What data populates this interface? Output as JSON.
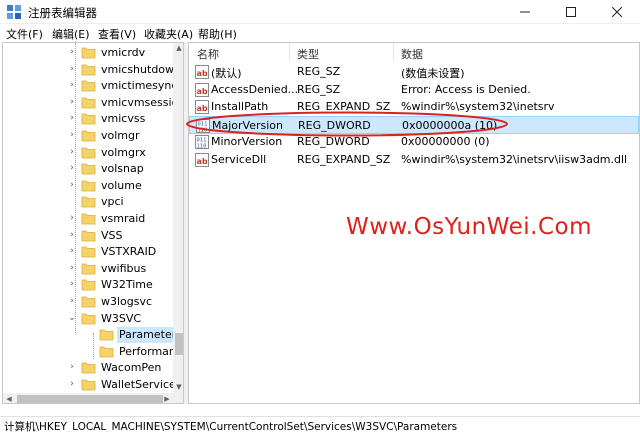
{
  "window": {
    "title": "注册表编辑器"
  },
  "menu": [
    "文件(F)",
    "编辑(E)",
    "查看(V)",
    "收藏夹(A)",
    "帮助(H)"
  ],
  "tree": {
    "items": [
      {
        "label": "vmicrdv",
        "expander": "›"
      },
      {
        "label": "vmicshutdown",
        "expander": "›"
      },
      {
        "label": "vmictimesync",
        "expander": "›"
      },
      {
        "label": "vmicvmsession",
        "expander": "›"
      },
      {
        "label": "vmicvss",
        "expander": "›"
      },
      {
        "label": "volmgr",
        "expander": "›"
      },
      {
        "label": "volmgrx",
        "expander": "›"
      },
      {
        "label": "volsnap",
        "expander": "›"
      },
      {
        "label": "volume",
        "expander": "›"
      },
      {
        "label": "vpci",
        "expander": ""
      },
      {
        "label": "vsmraid",
        "expander": "›"
      },
      {
        "label": "VSS",
        "expander": "›"
      },
      {
        "label": "VSTXRAID",
        "expander": "›"
      },
      {
        "label": "vwifibus",
        "expander": "›"
      },
      {
        "label": "W32Time",
        "expander": "›"
      },
      {
        "label": "w3logsvc",
        "expander": "›"
      },
      {
        "label": "W3SVC",
        "expander": "⌄"
      },
      {
        "label": "Parameters",
        "expander": "",
        "selected": true
      },
      {
        "label": "Performance",
        "expander": ""
      },
      {
        "label": "WacomPen",
        "expander": "›"
      },
      {
        "label": "WalletService",
        "expander": "›"
      }
    ]
  },
  "list": {
    "columns": [
      "名称",
      "类型",
      "数据"
    ],
    "rows": [
      {
        "icon": "string-value-icon",
        "name": "(默认)",
        "type": "REG_SZ",
        "data": "(数值未设置)"
      },
      {
        "icon": "string-value-icon",
        "name": "AccessDenied...",
        "type": "REG_SZ",
        "data": "Error: Access is Denied."
      },
      {
        "icon": "string-value-icon",
        "name": "InstallPath",
        "type": "REG_EXPAND_SZ",
        "data": "%windir%\\system32\\inetsrv"
      },
      {
        "icon": "dword-value-icon",
        "name": "MajorVersion",
        "type": "REG_DWORD",
        "data": "0x0000000a (10)",
        "selected": true
      },
      {
        "icon": "dword-value-icon",
        "name": "MinorVersion",
        "type": "REG_DWORD",
        "data": "0x00000000 (0)"
      },
      {
        "icon": "string-value-icon",
        "name": "ServiceDll",
        "type": "REG_EXPAND_SZ",
        "data": "%windir%\\system32\\inetsrv\\iisw3adm.dll"
      }
    ]
  },
  "watermark": "Www.OsYunWei.Com",
  "status": {
    "path": "计算机\\HKEY_LOCAL_MACHINE\\SYSTEM\\CurrentControlSet\\Services\\W3SVC\\Parameters"
  },
  "colors": {
    "selection": "#cce8ff",
    "folder": "#f6d36a",
    "watermark": "#e0201a",
    "oval": "#d8231f"
  }
}
